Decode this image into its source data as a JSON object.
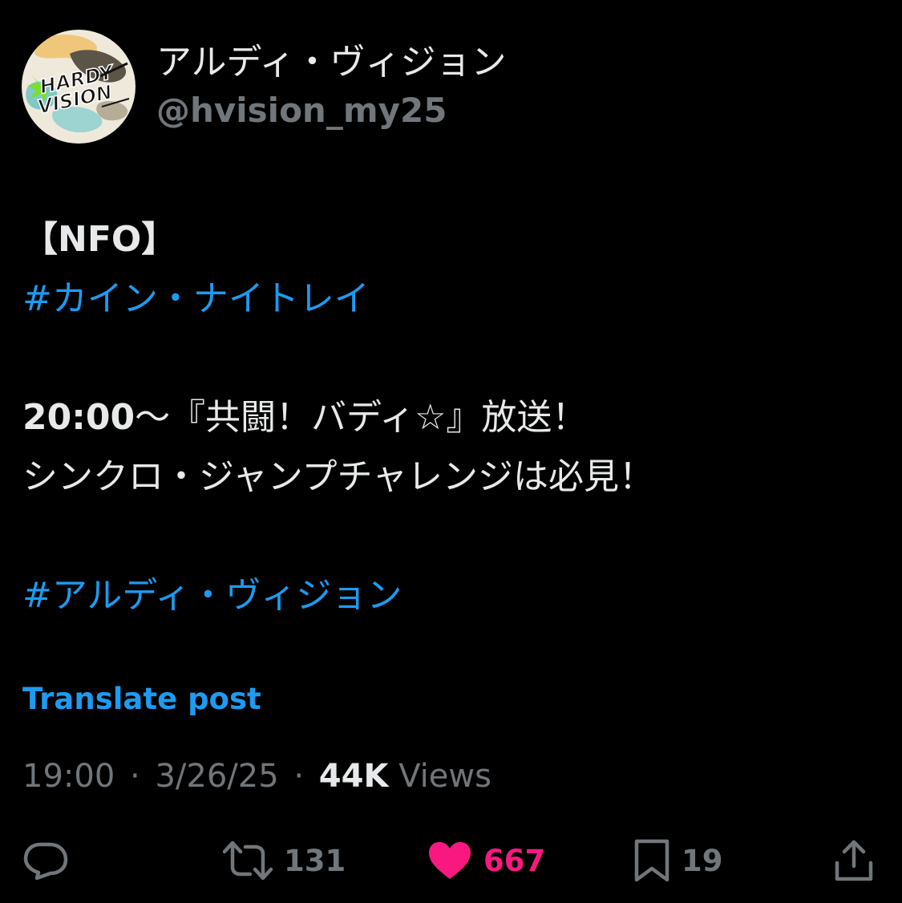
{
  "author": {
    "display_name": "アルディ・ヴィジョン",
    "handle": "@hvision_my25",
    "avatar_logo_text": [
      "HARDY",
      "VISION"
    ]
  },
  "post": {
    "line1": "【NFO】",
    "line2_hashtag": "#カイン・ナイトレイ",
    "line3_time": "20:00",
    "line3_rest": "～『共闘！バディ☆』放送！",
    "line4": "シンクロ・ジャンプチャレンジは必見！",
    "line5_hashtag": "#アルディ・ヴィジョン"
  },
  "translate_label": "Translate post",
  "meta": {
    "time": "19:00",
    "date": "3/26/25",
    "separator": "·",
    "views_count": "44K",
    "views_label": "Views"
  },
  "actions": {
    "reply": {
      "icon": "reply-icon",
      "count": ""
    },
    "repost": {
      "icon": "repost-icon",
      "count": "131"
    },
    "like": {
      "icon": "heart-icon",
      "count": "667",
      "liked": true
    },
    "bookmark": {
      "icon": "bookmark-icon",
      "count": "19"
    },
    "share": {
      "icon": "share-icon",
      "count": ""
    }
  },
  "colors": {
    "background": "#000000",
    "text_primary": "#e7e9ea",
    "text_secondary": "#71767b",
    "link": "#1d9bf0",
    "like": "#f91880"
  }
}
